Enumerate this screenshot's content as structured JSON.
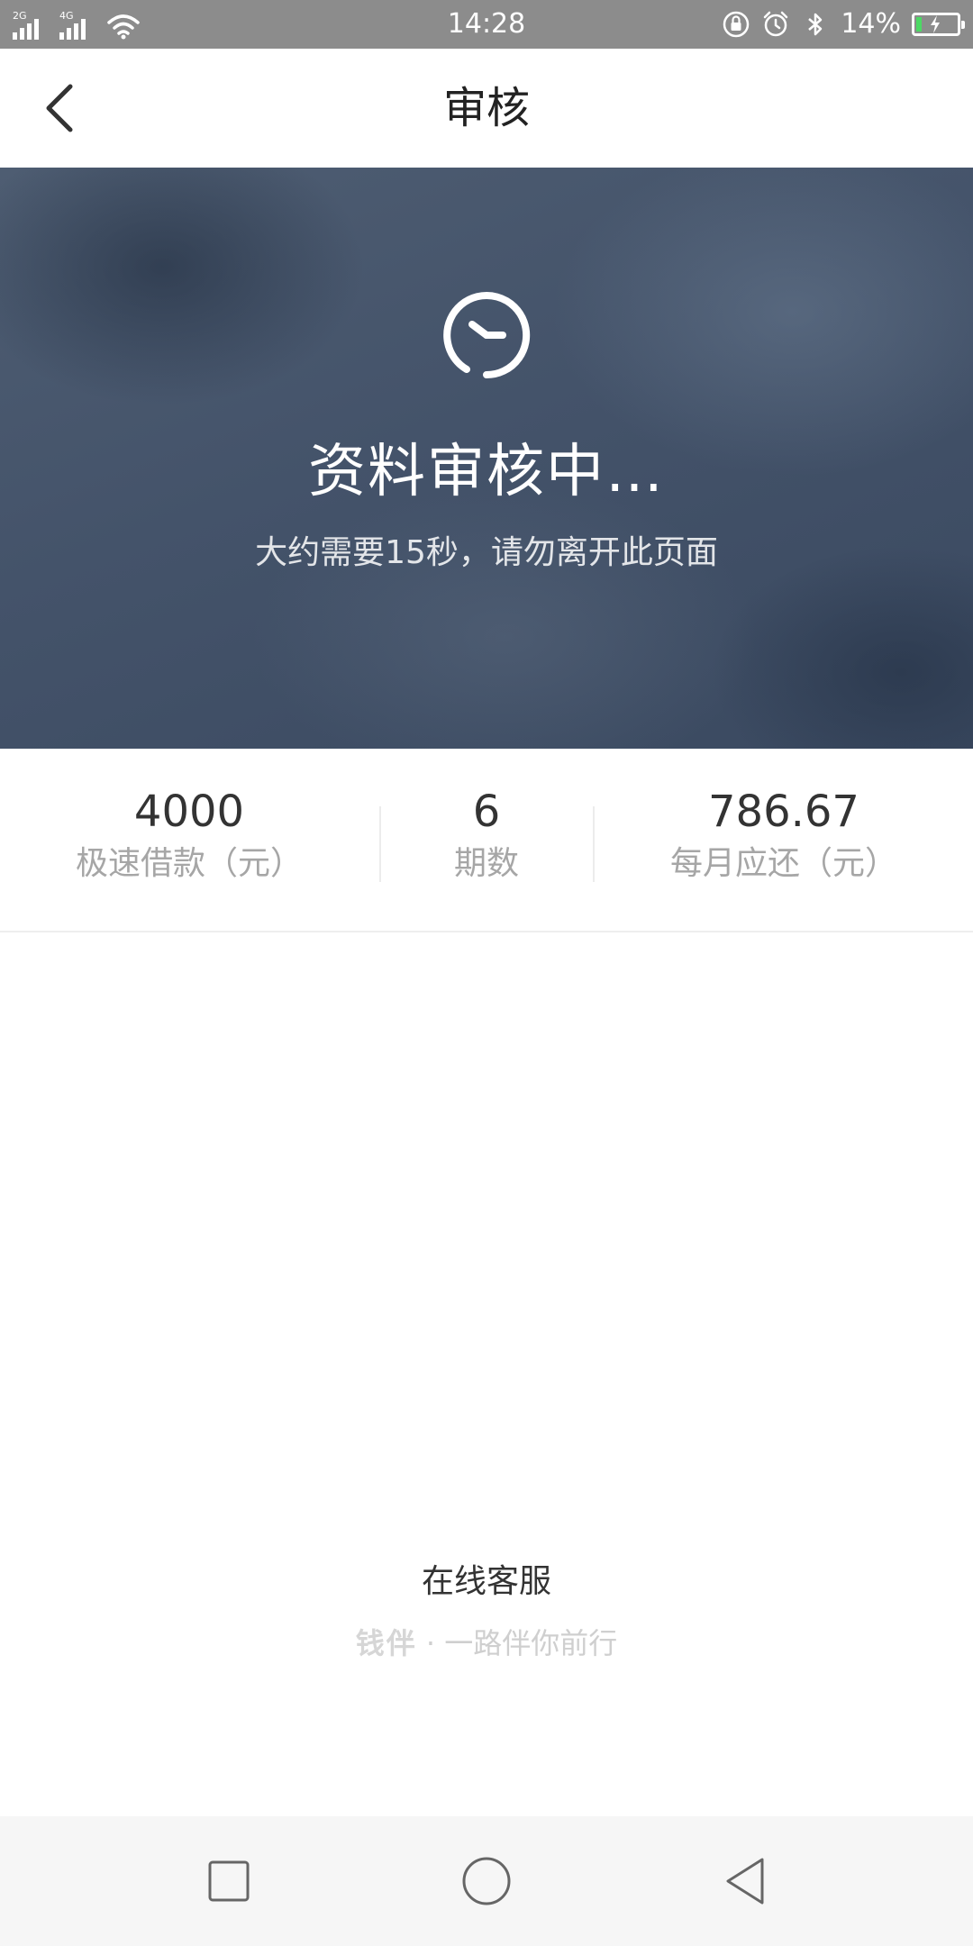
{
  "status_bar": {
    "network_1": "2G",
    "network_2": "4G",
    "time": "14:28",
    "battery_percent": "14%",
    "battery_level": 0.14,
    "icons": [
      "signal-icon",
      "wifi-icon",
      "lock-rotation-icon",
      "alarm-icon",
      "bluetooth-icon",
      "battery-charging-icon"
    ]
  },
  "header": {
    "title": "审核",
    "back_icon": "chevron-left-icon"
  },
  "hero": {
    "icon": "clock-icon",
    "title": "资料审核中…",
    "subtitle": "大约需要15秒，请勿离开此页面"
  },
  "stats": [
    {
      "value": "4000",
      "label": "极速借款（元）"
    },
    {
      "value": "6",
      "label": "期数"
    },
    {
      "value": "786.67",
      "label": "每月应还（元）"
    }
  ],
  "footer": {
    "service_label": "在线客服",
    "brand_name": "钱伴",
    "brand_separator": "·",
    "slogan": "一路伴你前行"
  },
  "nav_bar": {
    "icons": [
      "recent-apps-icon",
      "home-icon",
      "back-icon"
    ]
  },
  "colors": {
    "hero_bg": "#44536a",
    "status_bar_bg": "#8c8c8c",
    "nav_bar_bg": "#f6f6f6",
    "label_gray": "#a6a6a6",
    "battery_fill": "#4cd964"
  }
}
